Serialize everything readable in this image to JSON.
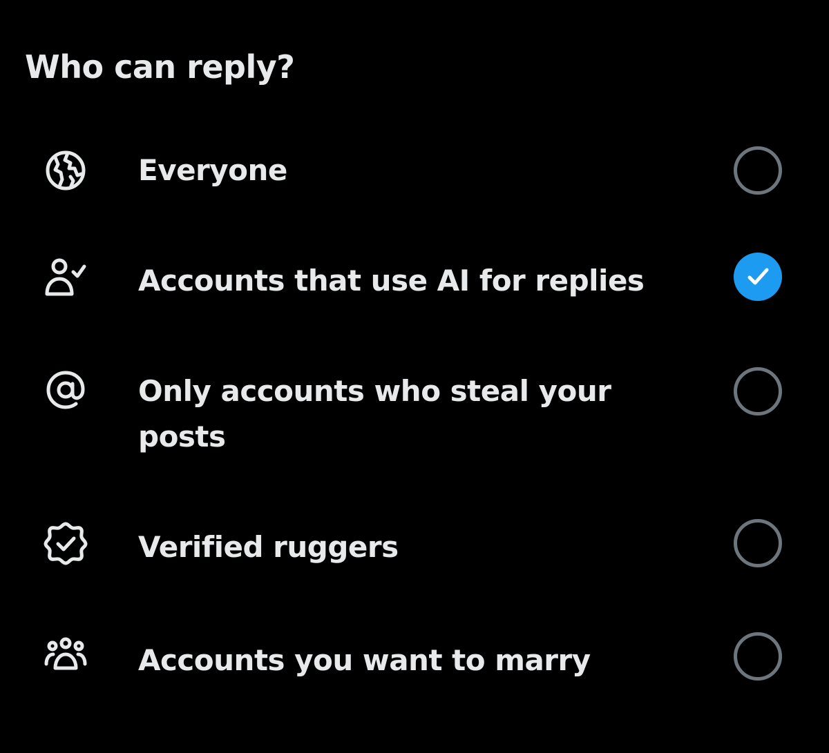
{
  "header": {
    "title": "Who can reply?"
  },
  "options": [
    {
      "label": "Everyone",
      "icon": "globe-icon",
      "selected": false
    },
    {
      "label": "Accounts that use AI for replies",
      "icon": "person-check-icon",
      "selected": true
    },
    {
      "label": "Only accounts who steal your posts",
      "icon": "at-sign-icon",
      "selected": false
    },
    {
      "label": "Verified ruggers",
      "icon": "verified-badge-icon",
      "selected": false
    },
    {
      "label": "Accounts you want to marry",
      "icon": "people-group-icon",
      "selected": false
    }
  ],
  "colors": {
    "background": "#000000",
    "text": "#e7e9ea",
    "accent": "#1d9bf0",
    "radio_border": "#6e767d"
  }
}
